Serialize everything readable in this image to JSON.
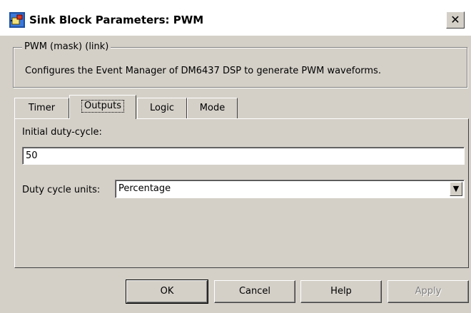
{
  "window": {
    "title": "Sink Block Parameters: PWM",
    "close_glyph": "✕"
  },
  "group": {
    "legend": "PWM (mask) (link)",
    "description": "Configures the Event Manager of DM6437 DSP to generate PWM waveforms."
  },
  "tabs": [
    {
      "label": "Timer",
      "active": false
    },
    {
      "label": "Outputs",
      "active": true
    },
    {
      "label": "Logic",
      "active": false
    },
    {
      "label": "Mode",
      "active": false
    }
  ],
  "panel": {
    "initial_duty_label": "Initial duty-cycle:",
    "initial_duty_value": "50",
    "units_label": "Duty cycle units:",
    "units_value": "Percentage"
  },
  "buttons": {
    "ok": "OK",
    "cancel": "Cancel",
    "help": "Help",
    "apply": "Apply"
  },
  "colors": {
    "face": "#d4d0c8",
    "disabled_text": "#808080"
  }
}
